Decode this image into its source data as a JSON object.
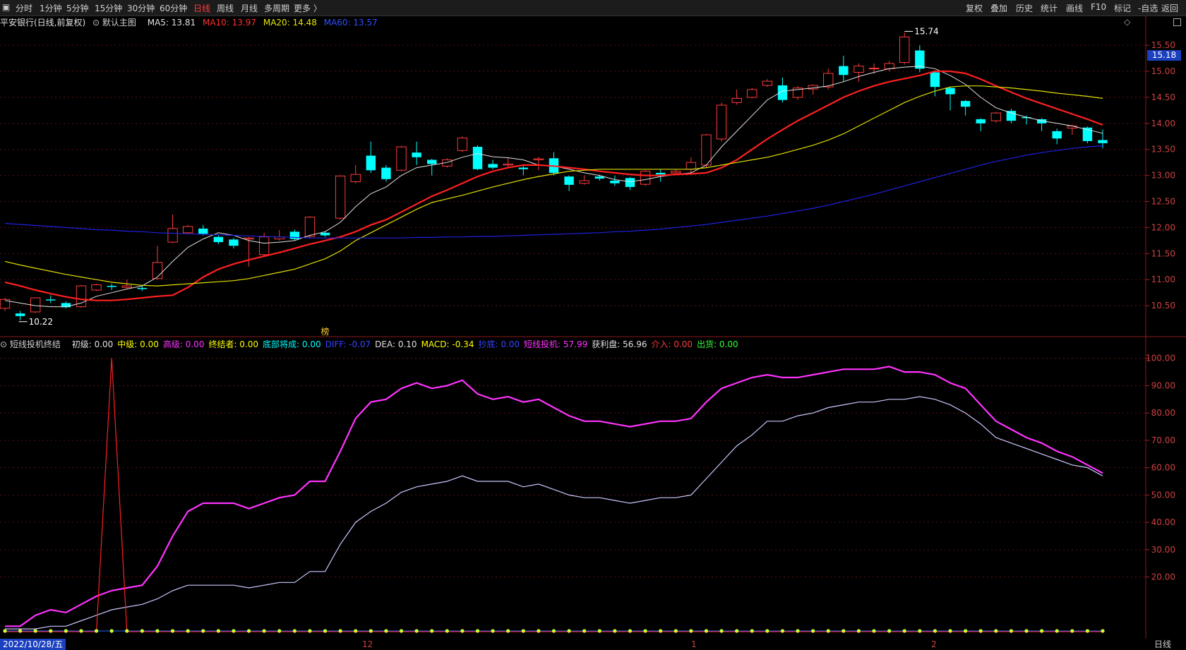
{
  "toolbar": {
    "left": [
      "分时",
      "1分钟",
      "5分钟",
      "15分钟",
      "30分钟",
      "60分钟",
      "日线",
      "周线",
      "月线",
      "多周期",
      "更多 〉"
    ],
    "active": "日线",
    "right": [
      "复权",
      "叠加",
      "历史",
      "统计",
      "画线",
      "F10",
      "标记",
      "-自选",
      "返回"
    ]
  },
  "upper_info": {
    "title": "平安银行(日线,前复权)",
    "main_label": "默认主图",
    "ma5": "MA5: 13.81",
    "ma10": "MA10: 13.97",
    "ma20": "MA20: 14.48",
    "ma60": "MA60: 13.57"
  },
  "lower_info": {
    "name": "短线投机终结",
    "items": [
      {
        "text": "初级: 0.00",
        "color": "#e0e0e0"
      },
      {
        "text": "中级: 0.00",
        "color": "#ffff00"
      },
      {
        "text": "高级: 0.00",
        "color": "#ff33ff"
      },
      {
        "text": "终结者: 0.00",
        "color": "#ffff00"
      },
      {
        "text": "底部将成: 0.00",
        "color": "#00ffff"
      },
      {
        "text": "DIFF: -0.07",
        "color": "#3344ff"
      },
      {
        "text": "DEA: 0.10",
        "color": "#e0e0e0"
      },
      {
        "text": "MACD: -0.34",
        "color": "#ffff00"
      },
      {
        "text": "抄底: 0.00",
        "color": "#3344ff"
      },
      {
        "text": "短线投机: 57.99",
        "color": "#ff33ff"
      },
      {
        "text": "获利盘: 56.96",
        "color": "#e0e0e0"
      },
      {
        "text": "介入: 0.00",
        "color": "#ff3b3b"
      },
      {
        "text": "出货: 0.00",
        "color": "#33ff33"
      }
    ]
  },
  "badge": "15.18",
  "date_label": "2022/10/28/五",
  "month_labels": [
    "12",
    "1",
    "2"
  ],
  "period_label": "日线",
  "colors": {
    "up": "#ff3b3b",
    "down": "#00ffff",
    "ma5": "#e0e0e0",
    "ma10": "#ff2020",
    "ma20": "#e0e000",
    "ma60": "#2020e0",
    "speculation": "#ff33ff",
    "profit": "#c8c8ff",
    "entry": "#ff2020",
    "dots": "#ccff33"
  },
  "chart_data": [
    {
      "type": "candlestick",
      "title": "平安银行(日线,前复权)",
      "yticks": [
        10.5,
        11.0,
        11.5,
        12.0,
        12.5,
        13.0,
        13.5,
        14.0,
        14.5,
        15.0,
        15.5
      ],
      "ylim": [
        10.0,
        15.8
      ],
      "annotations": [
        {
          "text": "15.74",
          "index": 59
        },
        {
          "text": "10.22",
          "index": 1
        },
        {
          "text": "榜",
          "index": 21
        }
      ],
      "candles": [
        [
          10.45,
          10.62,
          10.4,
          10.65
        ],
        [
          10.35,
          10.3,
          10.22,
          10.4
        ],
        [
          10.38,
          10.65,
          10.36,
          10.66
        ],
        [
          10.62,
          10.6,
          10.55,
          10.7
        ],
        [
          10.55,
          10.47,
          10.45,
          10.58
        ],
        [
          10.48,
          10.88,
          10.46,
          10.9
        ],
        [
          10.8,
          10.9,
          10.78,
          10.92
        ],
        [
          10.88,
          10.86,
          10.8,
          10.92
        ],
        [
          10.85,
          10.88,
          10.82,
          11.0
        ],
        [
          10.84,
          10.82,
          10.78,
          10.9
        ],
        [
          11.02,
          11.33,
          11.0,
          11.65
        ],
        [
          11.72,
          11.98,
          11.7,
          12.25
        ],
        [
          11.9,
          12.02,
          11.88,
          12.05
        ],
        [
          11.98,
          11.88,
          11.85,
          12.05
        ],
        [
          11.82,
          11.72,
          11.68,
          11.85
        ],
        [
          11.77,
          11.65,
          11.6,
          11.8
        ],
        [
          11.78,
          11.8,
          11.25,
          11.82
        ],
        [
          11.48,
          11.82,
          11.45,
          11.9
        ],
        [
          11.78,
          11.82,
          11.75,
          11.95
        ],
        [
          11.92,
          11.78,
          11.75,
          11.96
        ],
        [
          11.83,
          12.2,
          11.8,
          12.22
        ],
        [
          11.9,
          11.85,
          11.82,
          11.93
        ],
        [
          12.18,
          12.99,
          12.15,
          13.0
        ],
        [
          12.88,
          13.02,
          12.85,
          13.2
        ],
        [
          13.38,
          13.1,
          13.05,
          13.65
        ],
        [
          13.15,
          12.93,
          12.88,
          13.2
        ],
        [
          13.1,
          13.55,
          13.08,
          13.57
        ],
        [
          13.44,
          13.35,
          13.2,
          13.65
        ],
        [
          13.3,
          13.22,
          13.0,
          13.32
        ],
        [
          13.18,
          13.3,
          13.15,
          13.33
        ],
        [
          13.48,
          13.72,
          13.45,
          13.75
        ],
        [
          13.55,
          13.12,
          13.1,
          13.58
        ],
        [
          13.22,
          13.15,
          13.12,
          13.3
        ],
        [
          13.2,
          13.22,
          13.15,
          13.35
        ],
        [
          13.15,
          13.12,
          13.0,
          13.2
        ],
        [
          13.3,
          13.32,
          13.1,
          13.36
        ],
        [
          13.33,
          13.05,
          13.0,
          13.45
        ],
        [
          12.98,
          12.82,
          12.7,
          13.0
        ],
        [
          12.85,
          12.9,
          12.82,
          13.0
        ],
        [
          12.98,
          12.94,
          12.9,
          13.02
        ],
        [
          12.9,
          12.85,
          12.8,
          13.0
        ],
        [
          12.95,
          12.78,
          12.72,
          12.97
        ],
        [
          12.83,
          13.08,
          12.8,
          13.1
        ],
        [
          13.05,
          13.02,
          12.88,
          13.12
        ],
        [
          13.05,
          13.08,
          13.02,
          13.12
        ],
        [
          13.12,
          13.25,
          13.05,
          13.35
        ],
        [
          13.2,
          13.78,
          13.15,
          13.8
        ],
        [
          13.7,
          14.35,
          13.65,
          14.4
        ],
        [
          14.4,
          14.48,
          14.36,
          14.65
        ],
        [
          14.5,
          14.65,
          14.48,
          14.68
        ],
        [
          14.73,
          14.81,
          14.7,
          14.85
        ],
        [
          14.73,
          14.45,
          14.4,
          14.88
        ],
        [
          14.5,
          14.68,
          14.45,
          14.72
        ],
        [
          14.66,
          14.73,
          14.55,
          14.75
        ],
        [
          14.7,
          14.96,
          14.65,
          15.05
        ],
        [
          15.1,
          14.93,
          14.8,
          15.3
        ],
        [
          14.98,
          15.1,
          14.8,
          15.15
        ],
        [
          15.05,
          15.06,
          14.95,
          15.15
        ],
        [
          15.05,
          15.15,
          15.0,
          15.2
        ],
        [
          15.17,
          15.66,
          15.13,
          15.74
        ],
        [
          15.4,
          15.05,
          14.98,
          15.5
        ],
        [
          14.98,
          14.7,
          14.52,
          15.0
        ],
        [
          14.68,
          14.56,
          14.25,
          14.7
        ],
        [
          14.43,
          14.32,
          14.15,
          14.45
        ],
        [
          14.08,
          14.0,
          13.85,
          14.1
        ],
        [
          14.05,
          14.2,
          14.02,
          14.22
        ],
        [
          14.24,
          14.05,
          14.0,
          14.28
        ],
        [
          14.12,
          14.1,
          13.98,
          14.15
        ],
        [
          14.08,
          14.0,
          13.85,
          14.1
        ],
        [
          13.85,
          13.71,
          13.6,
          13.9
        ],
        [
          13.91,
          13.95,
          13.78,
          13.97
        ],
        [
          13.92,
          13.66,
          13.62,
          13.94
        ],
        [
          13.68,
          13.62,
          13.52,
          13.88
        ]
      ],
      "series": [
        {
          "name": "MA5",
          "start": 0,
          "values": [
            10.6,
            10.55,
            10.5,
            10.48,
            10.48,
            10.55,
            10.68,
            10.75,
            10.82,
            10.88,
            11.05,
            11.35,
            11.62,
            11.78,
            11.9,
            11.85,
            11.75,
            11.7,
            11.72,
            11.75,
            11.85,
            11.92,
            12.1,
            12.4,
            12.65,
            12.78,
            13.0,
            13.15,
            13.2,
            13.25,
            13.35,
            13.42,
            13.36,
            13.34,
            13.3,
            13.2,
            13.18,
            13.12,
            13.05,
            13.0,
            12.92,
            12.88,
            12.92,
            12.98,
            13.02,
            13.05,
            13.2,
            13.55,
            13.85,
            14.15,
            14.45,
            14.62,
            14.65,
            14.68,
            14.72,
            14.8,
            14.9,
            14.98,
            15.05,
            15.08,
            15.1,
            15.05,
            14.92,
            14.75,
            14.5,
            14.3,
            14.2,
            14.12,
            14.05,
            14.0,
            13.95,
            13.88,
            13.81
          ]
        },
        {
          "name": "MA10",
          "start": 0,
          "values": [
            10.95,
            10.88,
            10.8,
            10.73,
            10.67,
            10.62,
            10.6,
            10.6,
            10.62,
            10.65,
            10.68,
            10.7,
            10.85,
            11.05,
            11.2,
            11.3,
            11.38,
            11.45,
            11.52,
            11.6,
            11.68,
            11.75,
            11.82,
            11.92,
            12.05,
            12.15,
            12.3,
            12.45,
            12.6,
            12.72,
            12.85,
            12.98,
            13.08,
            13.15,
            13.2,
            13.2,
            13.18,
            13.15,
            13.12,
            13.08,
            13.05,
            13.02,
            13.0,
            13.0,
            13.02,
            13.03,
            13.05,
            13.15,
            13.3,
            13.5,
            13.7,
            13.88,
            14.05,
            14.2,
            14.35,
            14.5,
            14.62,
            14.72,
            14.8,
            14.86,
            14.92,
            15.0,
            15.0,
            14.96,
            14.85,
            14.72,
            14.6,
            14.48,
            14.38,
            14.28,
            14.18,
            14.08,
            13.97
          ]
        },
        {
          "name": "MA20",
          "start": 0,
          "values": [
            11.35,
            11.28,
            11.22,
            11.16,
            11.1,
            11.05,
            11.0,
            10.95,
            10.92,
            10.89,
            10.88,
            10.9,
            10.92,
            10.94,
            10.96,
            10.98,
            11.02,
            11.08,
            11.14,
            11.2,
            11.3,
            11.4,
            11.55,
            11.75,
            11.9,
            12.05,
            12.2,
            12.35,
            12.48,
            12.55,
            12.62,
            12.7,
            12.78,
            12.85,
            12.92,
            12.98,
            13.03,
            13.08,
            13.1,
            13.12,
            13.12,
            13.12,
            13.12,
            13.12,
            13.12,
            13.12,
            13.15,
            13.2,
            13.25,
            13.3,
            13.35,
            13.42,
            13.5,
            13.58,
            13.68,
            13.8,
            13.95,
            14.1,
            14.25,
            14.4,
            14.52,
            14.62,
            14.7,
            14.72,
            14.72,
            14.7,
            14.68,
            14.65,
            14.62,
            14.58,
            14.55,
            14.52,
            14.48
          ]
        },
        {
          "name": "MA60",
          "start": 0,
          "values": [
            12.08,
            12.06,
            12.04,
            12.02,
            12.0,
            11.98,
            11.96,
            11.95,
            11.93,
            11.92,
            11.9,
            11.89,
            11.88,
            11.87,
            11.86,
            11.85,
            11.84,
            11.83,
            11.82,
            11.81,
            11.8,
            11.8,
            11.8,
            11.8,
            11.8,
            11.8,
            11.8,
            11.81,
            11.81,
            11.82,
            11.82,
            11.83,
            11.83,
            11.84,
            11.85,
            11.86,
            11.87,
            11.88,
            11.89,
            11.9,
            11.92,
            11.93,
            11.95,
            11.97,
            12.0,
            12.03,
            12.06,
            12.1,
            12.14,
            12.18,
            12.22,
            12.27,
            12.32,
            12.37,
            12.43,
            12.5,
            12.57,
            12.64,
            12.72,
            12.8,
            12.88,
            12.96,
            13.04,
            13.12,
            13.2,
            13.27,
            13.33,
            13.39,
            13.44,
            13.48,
            13.52,
            13.55,
            13.57
          ]
        }
      ]
    },
    {
      "type": "line",
      "title": "短线投机终结",
      "yticks": [
        20.0,
        30.0,
        40.0,
        50.0,
        60.0,
        70.0,
        80.0,
        90.0,
        100.0
      ],
      "ylim": [
        0,
        102
      ],
      "series": [
        {
          "name": "短线投机",
          "values": [
            2,
            2,
            6,
            8,
            7,
            10,
            13,
            15,
            16,
            17,
            24,
            35,
            44,
            47,
            47,
            47,
            45,
            47,
            49,
            50,
            55,
            55,
            66,
            78,
            84,
            85,
            89,
            91,
            89,
            90,
            92,
            87,
            85,
            86,
            84,
            85,
            82,
            79,
            77,
            77,
            76,
            75,
            76,
            77,
            77,
            78,
            84,
            89,
            91,
            93,
            94,
            93,
            93,
            94,
            95,
            96,
            96,
            96,
            97,
            95,
            95,
            94,
            91,
            89,
            83,
            77,
            74,
            71,
            69,
            66,
            64,
            61,
            58
          ]
        },
        {
          "name": "获利盘",
          "values": [
            1,
            1,
            1,
            2,
            2,
            4,
            6,
            8,
            9,
            10,
            12,
            15,
            17,
            17,
            17,
            17,
            16,
            17,
            18,
            18,
            22,
            22,
            32,
            40,
            44,
            47,
            51,
            53,
            54,
            55,
            57,
            55,
            55,
            55,
            53,
            54,
            52,
            50,
            49,
            49,
            48,
            47,
            48,
            49,
            49,
            50,
            56,
            62,
            68,
            72,
            77,
            77,
            79,
            80,
            82,
            83,
            84,
            84,
            85,
            85,
            86,
            85,
            83,
            80,
            76,
            71,
            69,
            67,
            65,
            63,
            61,
            60,
            57
          ]
        },
        {
          "name": "介入",
          "values": [
            0,
            0,
            0,
            0,
            0,
            0,
            0,
            100,
            0,
            0,
            0,
            0,
            0,
            0,
            0,
            0,
            0,
            0,
            0,
            0,
            0,
            0,
            0,
            0,
            0,
            0,
            0,
            0,
            0,
            0,
            0,
            0,
            0,
            0,
            0,
            0,
            0,
            0,
            0,
            0,
            0,
            0,
            0,
            0,
            0,
            0,
            0,
            0,
            0,
            0,
            0,
            0,
            0,
            0,
            0,
            0,
            0,
            0,
            0,
            0,
            0,
            0,
            0,
            0,
            0,
            0,
            0,
            0,
            0,
            0,
            0,
            0,
            0
          ]
        }
      ]
    }
  ]
}
